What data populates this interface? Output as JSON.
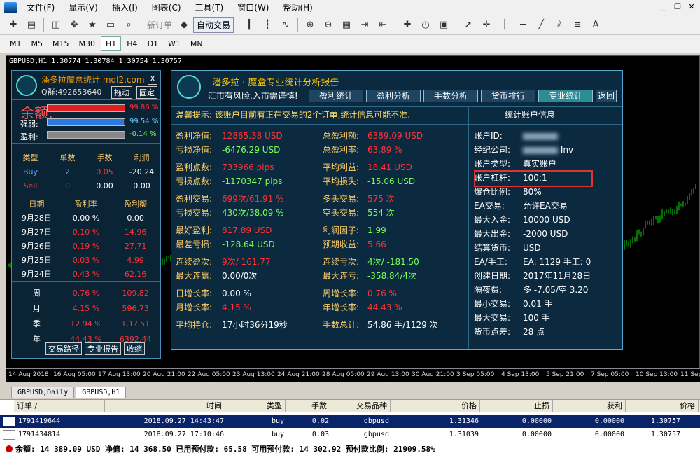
{
  "menu": {
    "items": [
      "文件(F)",
      "显示(V)",
      "插入(I)",
      "图表(C)",
      "工具(T)",
      "窗口(W)",
      "帮助(H)"
    ]
  },
  "toolbar": {
    "new_order": "新订单",
    "auto_trade": "自动交易"
  },
  "timeframes": [
    "M1",
    "M5",
    "M15",
    "M30",
    "H1",
    "H4",
    "D1",
    "W1",
    "MN"
  ],
  "active_timeframe": "H1",
  "chart": {
    "symbol_line": "GBPUSD,H1  1.30774 1.30784 1.30754 1.30757"
  },
  "xaxis": [
    "14 Aug 2018",
    "16 Aug 05:00",
    "17 Aug 13:00",
    "20 Aug 21:00",
    "22 Aug 05:00",
    "23 Aug 13:00",
    "24 Aug 21:00",
    "28 Aug 05:00",
    "29 Aug 13:00",
    "30 Aug 21:00",
    "3 Sep 05:00",
    "4 Sep 13:00",
    "5 Sep 21:00",
    "7 Sep 05:00",
    "10 Sep 13:00",
    "11 Sep"
  ],
  "panel1": {
    "title": "潘多拉魔盒统计 mql2.com",
    "qq": "Q群:492653640",
    "close": "X",
    "drag": "拖动",
    "pin": "固定",
    "balance_label": "余额:",
    "equity_label": "强弱:",
    "profit_label": "盈利:",
    "balance_pct": "99.86 %",
    "equity_pct": "99.54 %",
    "profit_pct": "-0.14 %",
    "balance_fill": 0.9986,
    "equity_fill": 0.9954,
    "trade_head": [
      "类型",
      "单数",
      "手数",
      "利润"
    ],
    "trades": [
      [
        "Buy",
        "2",
        "0.05",
        "-20.24"
      ],
      [
        "Sell",
        "0",
        "0.00",
        "0.00"
      ]
    ],
    "day_head": [
      "日期",
      "盈利率",
      "盈利额"
    ],
    "days": [
      [
        "9月28日",
        "0.00 %",
        "0.00"
      ],
      [
        "9月27日",
        "0.10 %",
        "14.96"
      ],
      [
        "9月26日",
        "0.19 %",
        "27.71"
      ],
      [
        "9月25日",
        "0.03 %",
        "4.99"
      ],
      [
        "9月24日",
        "0.43 %",
        "62.16"
      ]
    ],
    "periods": [
      [
        "周",
        "0.76 %",
        "109.82"
      ],
      [
        "月",
        "4.15 %",
        "596.73"
      ],
      [
        "季",
        "12.94 %",
        "1,1?.51"
      ],
      [
        "年",
        "44.43 %",
        "6392.44"
      ]
    ],
    "btn_path": "交易路径",
    "btn_report": "专业报告",
    "btn_collapse": "收缩"
  },
  "panel2": {
    "title": "潘多拉 · 魔盒专业统计分析报告",
    "subtitle": "汇市有风险,入市需谨慎!",
    "tabs": [
      "盈利统计",
      "盈利分析",
      "手数分析",
      "货币排行",
      "专业统计",
      "返回"
    ],
    "warning": "温馨提示: 该账户目前有正在交易的2个订单,统计信息可能不准.",
    "acc_title": "统计账户信息",
    "left_stats": [
      [
        "盈利净值:",
        "12865.38 USD",
        "red"
      ],
      [
        "亏损净值:",
        "-6476.29 USD",
        "grn"
      ],
      [
        "盈利点数:",
        "733966 pips",
        "red"
      ],
      [
        "亏损点数:",
        "-1170347 pips",
        "grn"
      ],
      [
        "盈利交易:",
        "699次/61.91 %",
        "red"
      ],
      [
        "亏损交易:",
        "430次/38.09 %",
        "grn"
      ],
      [
        "最好盈利:",
        "817.89 USD",
        "red"
      ],
      [
        "最差亏损:",
        "-128.64 USD",
        "grn"
      ],
      [
        "连续盈次:",
        "9次/ 161.77",
        "red"
      ],
      [
        "最大连赢:",
        "0.00/0次",
        "wht"
      ],
      [
        "日增长率:",
        "0.00 %",
        "wht"
      ],
      [
        "月增长率:",
        "4.15 %",
        "red"
      ],
      [
        "平均持仓:",
        "17小时36分19秒",
        "wht"
      ]
    ],
    "mid_stats": [
      [
        "总盈利额:",
        "6389.09 USD",
        "red"
      ],
      [
        "总盈利率:",
        "63.89 %",
        "red"
      ],
      [
        "平均利益:",
        "18.41 USD",
        "red"
      ],
      [
        "平均损失:",
        "-15.06 USD",
        "grn"
      ],
      [
        "多头交易:",
        "575 次",
        "red"
      ],
      [
        "空头交易:",
        "554 次",
        "grn"
      ],
      [
        "利润因子:",
        "1.99",
        "grn"
      ],
      [
        "预期收益:",
        "5.66",
        "red"
      ],
      [
        "连续亏次:",
        "4次/ -181.50",
        "grn"
      ],
      [
        "最大连亏:",
        "-358.84/4次",
        "grn"
      ],
      [
        "周增长率:",
        "0.76 %",
        "red"
      ],
      [
        "年增长率:",
        "44.43 %",
        "red"
      ],
      [
        "手数总计:",
        "54.86 手/1129 次",
        "wht"
      ]
    ],
    "account": [
      [
        "账户ID:",
        ""
      ],
      [
        "经纪公司:",
        "Inv"
      ],
      [
        "账户类型:",
        "真实账户"
      ],
      [
        "账户杠杆:",
        "100:1"
      ],
      [
        "爆仓比例:",
        "80%"
      ],
      [
        "EA交易:",
        "允许EA交易"
      ],
      [
        "最大入金:",
        "10000 USD"
      ],
      [
        "最大出金:",
        "-2000 USD"
      ],
      [
        "结算货币:",
        "USD"
      ],
      [
        "EA/手工:",
        "EA: 1129 手工: 0"
      ],
      [
        "创建日期:",
        "2017年11月28日"
      ],
      [
        "隔夜费:",
        "多 -7.05/空 3.20"
      ],
      [
        "最小交易:",
        "0.01 手"
      ],
      [
        "最大交易:",
        "100 手"
      ],
      [
        "货币点差:",
        "28 点"
      ]
    ]
  },
  "chart_tabs": [
    "GBPUSD,Daily",
    "GBPUSD,H1"
  ],
  "terminal": {
    "headers": [
      "订单 /",
      "时间",
      "类型",
      "手数",
      "交易品种",
      "价格",
      "止损",
      "获利",
      "价格"
    ],
    "rows": [
      [
        "1791419644",
        "2018.09.27 14:43:47",
        "buy",
        "0.02",
        "gbpusd",
        "1.31346",
        "0.00000",
        "0.00000",
        "1.30757"
      ],
      [
        "1791434814",
        "2018.09.27 17:10:46",
        "buy",
        "0.03",
        "gbpusd",
        "1.31039",
        "0.00000",
        "0.00000",
        "1.30757"
      ]
    ],
    "summary": "余额: 14 389.09 USD  净值: 14 368.50  已用预付款: 65.58  可用预付款: 14 302.92  预付款比例: 21909.58%"
  }
}
